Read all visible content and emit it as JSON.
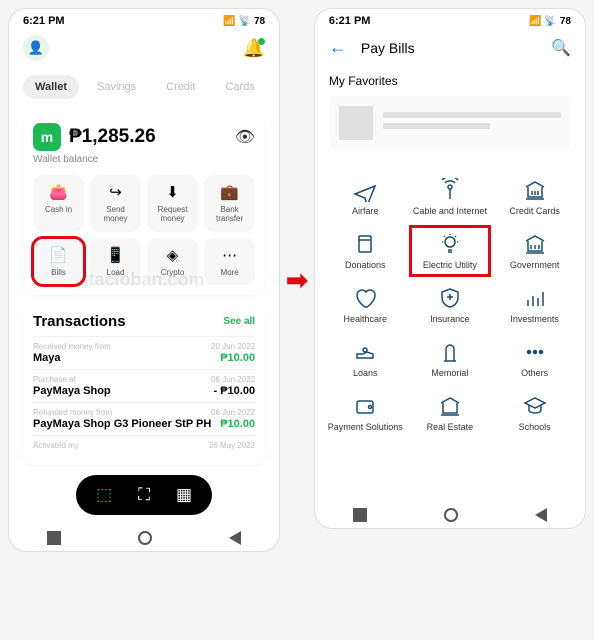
{
  "status": {
    "time": "6:21 PM",
    "battery": "78"
  },
  "left": {
    "tabs": [
      "Wallet",
      "Savings",
      "Credit",
      "Cards"
    ],
    "balance": {
      "amount": "₱1,285.26",
      "label": "Wallet balance"
    },
    "actions": [
      {
        "label": "Cash in"
      },
      {
        "label": "Send money"
      },
      {
        "label": "Request money"
      },
      {
        "label": "Bank transfer"
      },
      {
        "label": "Bills"
      },
      {
        "label": "Load"
      },
      {
        "label": "Crypto"
      },
      {
        "label": "More"
      }
    ],
    "tx": {
      "title": "Transactions",
      "see_all": "See all",
      "items": [
        {
          "desc": "Received money from",
          "date": "20 Jun 2022",
          "name": "Maya",
          "amount": "₱10.00",
          "sign": "pos"
        },
        {
          "desc": "Purchase at",
          "date": "06 Jun 2022",
          "name": "PayMaya Shop",
          "amount": "- ₱10.00",
          "sign": "neg"
        },
        {
          "desc": "Refunded money from",
          "date": "06 Jun 2022",
          "name": "PayMaya Shop   G3 Pioneer StP PH",
          "amount": "₱10.00",
          "sign": "pos"
        },
        {
          "desc": "Activated my",
          "date": "26 May 2022",
          "name": "",
          "amount": "",
          "sign": ""
        }
      ]
    }
  },
  "right": {
    "title": "Pay Bills",
    "favorites": "My Favorites",
    "categories": [
      "Airfare",
      "Cable and Internet",
      "Credit Cards",
      "Donations",
      "Electric Utility",
      "Government",
      "Healthcare",
      "Insurance",
      "Investments",
      "Loans",
      "Memorial",
      "Others",
      "Payment Solutions",
      "Real Estate",
      "Schools"
    ]
  },
  "watermark": "itacloban.com"
}
